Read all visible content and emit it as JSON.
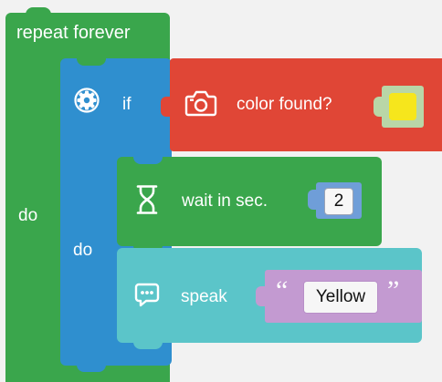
{
  "workspace": {
    "repeat_block": {
      "label": "repeat forever",
      "do_label": "do"
    },
    "if_block": {
      "label": "if",
      "do_label": "do"
    },
    "condition_block": {
      "label": "color found?",
      "color_value": "#f6e61c"
    },
    "wait_block": {
      "label": "wait in sec.",
      "value": "2"
    },
    "speak_block": {
      "label": "speak",
      "open_quote": "“",
      "value": "Yellow",
      "close_quote": "”"
    }
  },
  "colors": {
    "repeat": "#3aa64c",
    "if": "#2f8fcf",
    "condition": "#e04636",
    "wait": "#3aa64c",
    "speak": "#5bc5c9",
    "text_block": "#c39ad1",
    "background": "#f2f2f2"
  },
  "icons": {
    "if_block": "gear-icon",
    "condition_block": "camera-icon",
    "wait_block": "hourglass-icon",
    "speak_block": "speech-bubble-icon"
  }
}
